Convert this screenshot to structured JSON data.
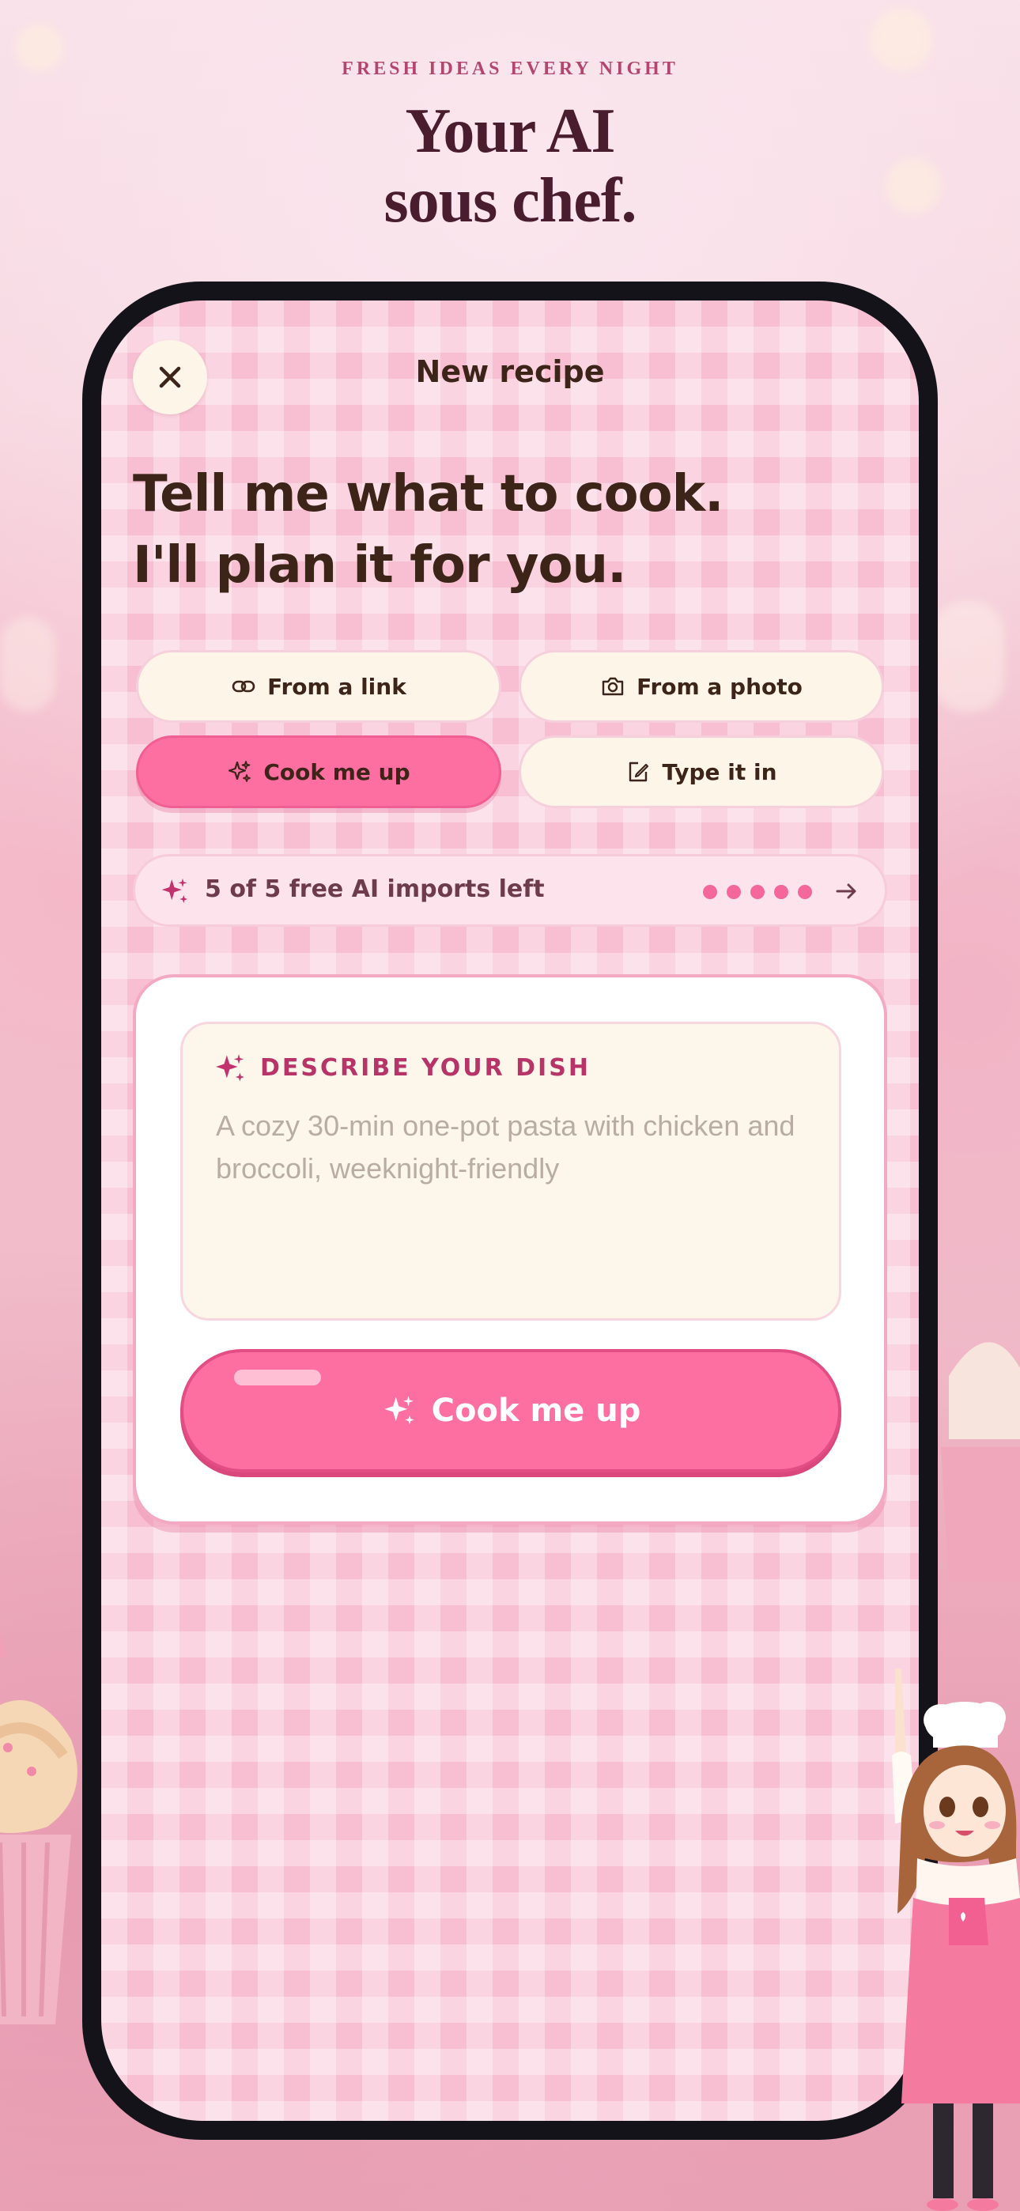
{
  "hero": {
    "kicker": "FRESH IDEAS EVERY NIGHT",
    "title_line1": "Your AI",
    "title_line2": "sous chef."
  },
  "header": {
    "close_icon": "close-icon",
    "title": "New recipe"
  },
  "headline": {
    "line1": "Tell me what to cook.",
    "line2": "I'll plan it for you."
  },
  "modes": [
    {
      "label": "From a link",
      "icon": "link-icon",
      "active": false
    },
    {
      "label": "From a photo",
      "icon": "camera-icon",
      "active": false
    },
    {
      "label": "Cook me up",
      "icon": "sparkles-icon",
      "active": true
    },
    {
      "label": "Type it in",
      "icon": "edit-icon",
      "active": false
    }
  ],
  "quota": {
    "text": "5 of 5 free AI imports left",
    "remaining": 5,
    "total": 5
  },
  "prompt": {
    "label": "DESCRIBE YOUR DISH",
    "value": "",
    "placeholder": "A cozy 30-min one-pot pasta with chicken and broccoli, weeknight-friendly"
  },
  "cta": {
    "label": "Cook me up"
  },
  "colors": {
    "accent_pink": "#fd6fa0",
    "cream": "#fdf5e8",
    "text_brown": "#3d2418",
    "label_magenta": "#b73468"
  }
}
